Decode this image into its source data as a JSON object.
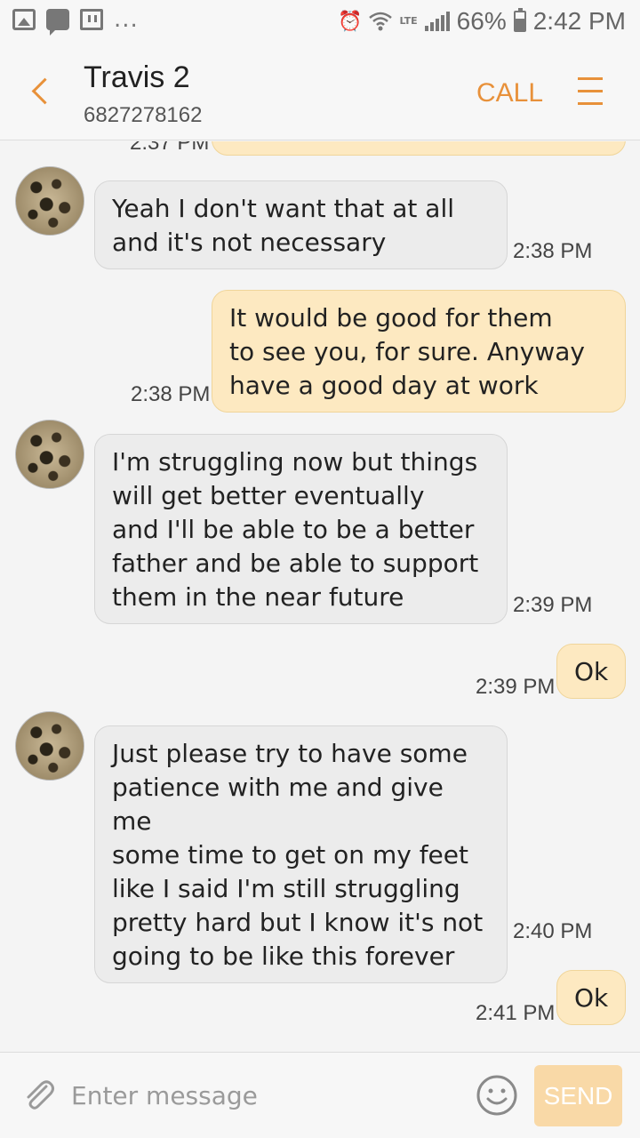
{
  "status_bar": {
    "notification_dots": "...",
    "network": "LTE",
    "battery": "66%",
    "battery_level": 0.66,
    "time": "2:42 PM",
    "icons": [
      "gallery-icon",
      "chat-icon",
      "twitch-icon",
      "alarm-icon",
      "wifi-icon",
      "signal-icon",
      "battery-icon"
    ]
  },
  "header": {
    "contact_name": "Travis 2",
    "contact_number": "6827278162",
    "call_label": "CALL"
  },
  "conversation": {
    "partial_timestamp": "2:37 PM",
    "messages": [
      {
        "direction": "incoming",
        "text": "Yeah I don't want that at all\nand it's not necessary",
        "time": "2:38 PM"
      },
      {
        "direction": "outgoing",
        "text": "It would be good for them\nto see you, for sure. Anyway\nhave a good day at work",
        "time": "2:38 PM"
      },
      {
        "direction": "incoming",
        "text": "I'm struggling now but things\nwill get better eventually\nand I'll be able to be a better\nfather and be able to support\nthem in the near future",
        "time": "2:39 PM"
      },
      {
        "direction": "outgoing",
        "text": "Ok",
        "time": "2:39 PM"
      },
      {
        "direction": "incoming",
        "text": "Just please try to have some\npatience with me and give me\nsome time to get on my feet\nlike I said I'm still struggling\npretty hard but I know it's not\ngoing to be like this forever",
        "time": "2:40 PM"
      },
      {
        "direction": "outgoing",
        "text": "Ok",
        "time": "2:41 PM"
      }
    ]
  },
  "composer": {
    "placeholder": "Enter message",
    "send_label": "SEND"
  },
  "colors": {
    "accent": "#e8913a",
    "incoming_bubble": "#ececec",
    "outgoing_bubble": "#fde9c1",
    "send_button": "#f9d9a7"
  }
}
